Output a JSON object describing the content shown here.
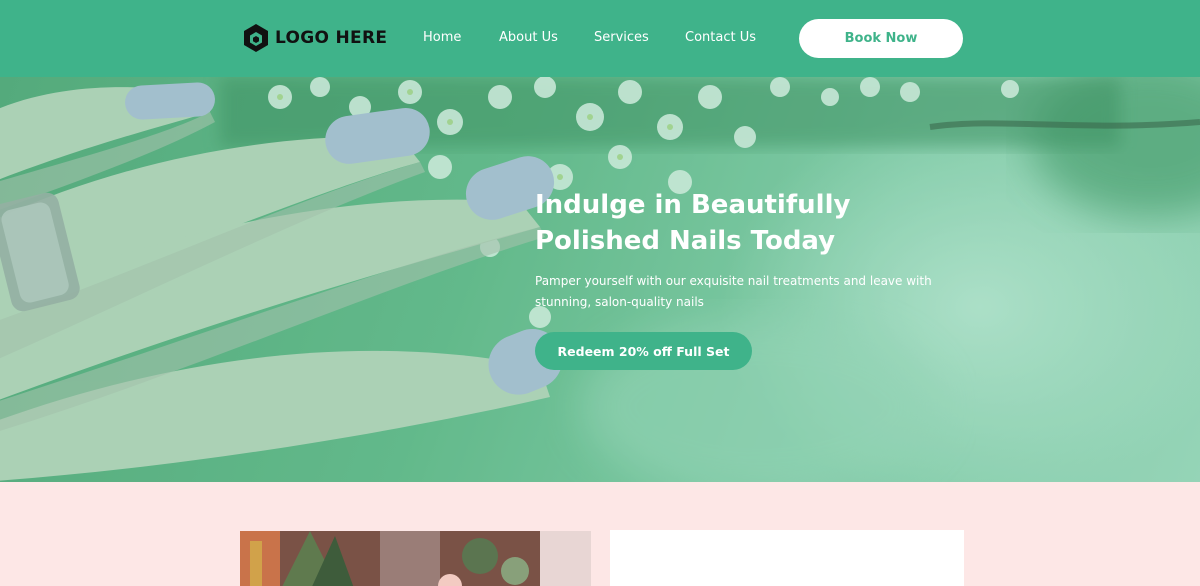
{
  "header": {
    "logo_text": "LOGO HERE",
    "nav": [
      {
        "label": "Home"
      },
      {
        "label": "About Us"
      },
      {
        "label": "Services"
      },
      {
        "label": "Contact Us"
      }
    ],
    "cta_label": "Book Now"
  },
  "hero": {
    "title": "Indulge in Beautifully Polished Nails Today",
    "subtitle": "Pamper yourself with our exquisite nail treatments and leave with stunning, salon-quality nails",
    "cta_label": "Redeem 20% off Full Set"
  },
  "colors": {
    "brand": "#3fb38a",
    "section_bg": "#fde7e6",
    "nail_polish": "#b9c3dc"
  },
  "icons": {
    "logo": "hexagon-logo-icon"
  }
}
